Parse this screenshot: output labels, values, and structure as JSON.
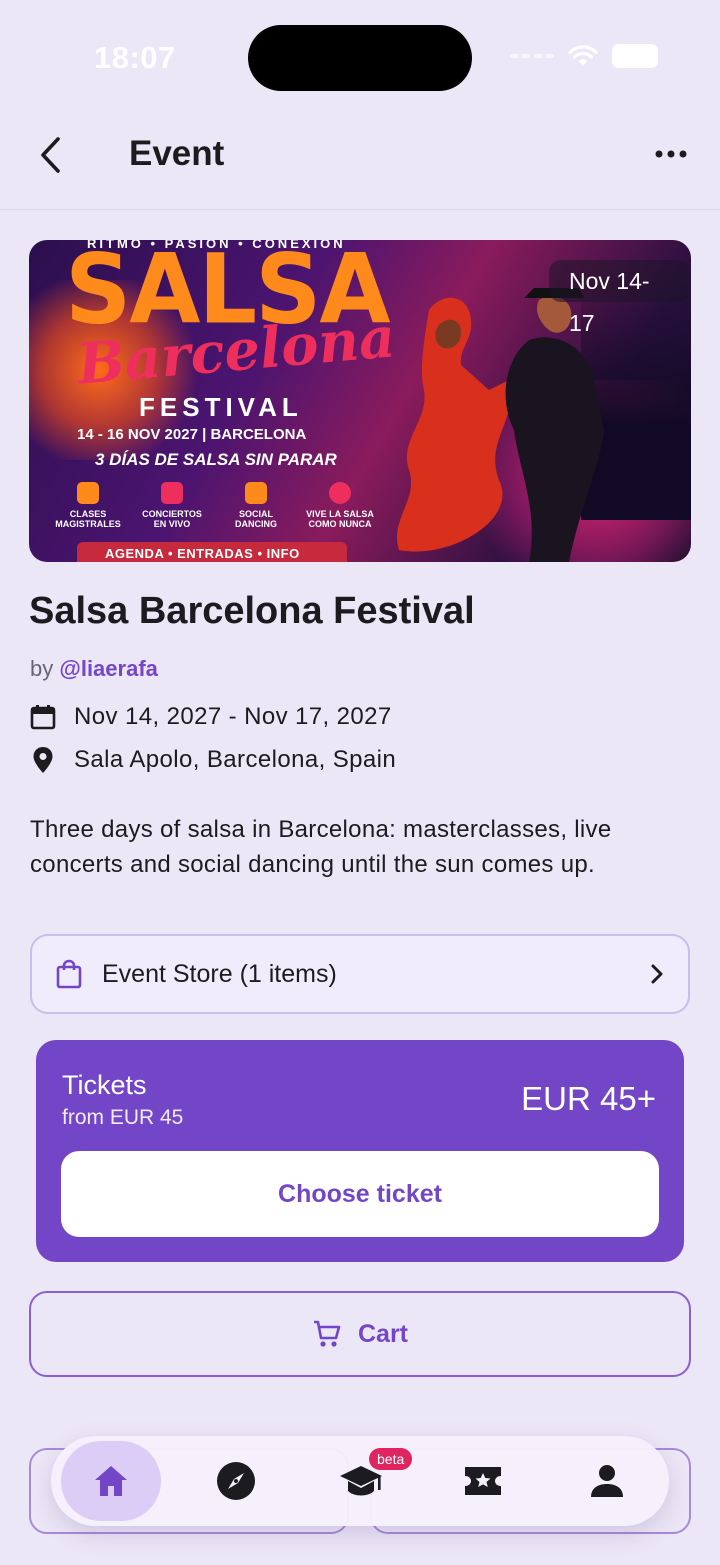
{
  "status": {
    "time": "18:07"
  },
  "app_bar": {
    "title": "Event"
  },
  "banner": {
    "tagline_top": "RITMO • PASIÓN • CONEXIÓN",
    "salsa": "SALSA",
    "barcelona": "Barcelona",
    "festival": "FESTIVAL",
    "dates_line": "14 - 16 NOV 2027  |  BARCELONA",
    "subline": "3 DÍAS DE SALSA SIN PARAR",
    "features": [
      "CLASES MAGISTRALES",
      "CONCIERTOS EN VIVO",
      "SOCIAL DANCING",
      "VIVE LA SALSA COMO NUNCA"
    ],
    "bottom_strip": "AGENDA • ENTRADAS • INFO",
    "date_badge": "Nov 14-17"
  },
  "event": {
    "title": "Salsa Barcelona Festival",
    "by_prefix": "by",
    "organizer_handle": "@liaerafa",
    "dates": "Nov 14, 2027 - Nov 17, 2027",
    "location": "Sala Apolo, Barcelona, Spain",
    "description": "Three days of salsa in Barcelona: masterclasses, live concerts and social dancing until the sun comes up."
  },
  "store": {
    "label": "Event Store (1 items)"
  },
  "tickets": {
    "title": "Tickets",
    "subtitle": "from EUR 45",
    "price": "EUR 45+",
    "choose_label": "Choose ticket"
  },
  "cart": {
    "label": "Cart"
  },
  "bottom_nav": {
    "items": [
      "home-icon",
      "compass-icon",
      "graduation-cap-icon",
      "ticket-star-icon",
      "person-icon"
    ],
    "beta_badge": "beta"
  },
  "colors": {
    "accent": "#7346c8",
    "background": "#ece7f6",
    "badge": "#e0245f"
  }
}
